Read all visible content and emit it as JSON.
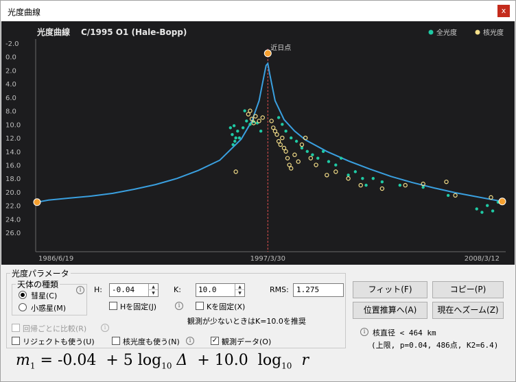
{
  "window": {
    "title": "光度曲線",
    "close_glyph": "x"
  },
  "chart": {
    "title": "光度曲線",
    "object": "C/1995 O1 (Hale-Bopp)",
    "legend": [
      "全光度",
      "核光度"
    ],
    "perihelion_label": "近日点",
    "colors": {
      "total": "#1fc9a4",
      "nucleus": "#f6e08a",
      "curve": "#3aa0e0",
      "marker": "#f5a030",
      "bg": "#1c1c1e"
    }
  },
  "chart_data": {
    "type": "scatter",
    "x_tick_labels": [
      "1986/6/19",
      "1997/3/30",
      "2008/3/12"
    ],
    "y_ticks": [
      "-2.0",
      "0.0",
      "2.0",
      "4.0",
      "6.0",
      "8.0",
      "10.0",
      "12.0",
      "14.0",
      "16.0",
      "18.0",
      "20.0",
      "22.0",
      "24.0",
      "26.0"
    ],
    "ylim": [
      -2,
      27
    ],
    "y_inverted": true,
    "xlim": [
      "1986/6/19",
      "2008/3/12"
    ],
    "perihelion": "1997/3/30",
    "model_curve": [
      [
        "1986/6/19",
        21.5
      ],
      [
        "1987/1/1",
        21.2
      ],
      [
        "1988/1/1",
        20.9
      ],
      [
        "1989/1/1",
        20.6
      ],
      [
        "1990/1/1",
        20.2
      ],
      [
        "1991/1/1",
        19.6
      ],
      [
        "1992/1/1",
        18.9
      ],
      [
        "1993/1/1",
        18.0
      ],
      [
        "1994/1/1",
        16.8
      ],
      [
        "1995/1/1",
        15.3
      ],
      [
        "1996/1/1",
        12.2
      ],
      [
        "1996/7/1",
        9.5
      ],
      [
        "1996/11/1",
        6.5
      ],
      [
        "1997/1/15",
        3.2
      ],
      [
        "1997/3/1",
        1.3
      ],
      [
        "1997/3/30",
        1.0
      ],
      [
        "1997/5/1",
        2.5
      ],
      [
        "1997/8/1",
        6.5
      ],
      [
        "1998/1/1",
        9.3
      ],
      [
        "1998/7/1",
        11.0
      ],
      [
        "1999/1/1",
        12.3
      ],
      [
        "2000/1/1",
        14.0
      ],
      [
        "2001/1/1",
        15.4
      ],
      [
        "2002/1/1",
        16.6
      ],
      [
        "2003/1/1",
        17.7
      ],
      [
        "2004/1/1",
        18.6
      ],
      [
        "2005/1/1",
        19.4
      ],
      [
        "2006/1/1",
        20.1
      ],
      [
        "2007/1/1",
        20.7
      ],
      [
        "2008/3/12",
        21.4
      ]
    ],
    "series": [
      {
        "name": "全光度",
        "points": [
          [
            "1995/7/1",
            10.5
          ],
          [
            "1995/8/1",
            11.5
          ],
          [
            "1995/9/1",
            10.2
          ],
          [
            "1995/10/1",
            12.0
          ],
          [
            "1995/11/1",
            11.0
          ],
          [
            "1996/2/1",
            10.5
          ],
          [
            "1996/4/1",
            9.5
          ],
          [
            "1996/6/1",
            10.0
          ],
          [
            "1996/8/1",
            9.6
          ],
          [
            "1996/10/1",
            9.8
          ],
          [
            "1996/12/1",
            11.0
          ],
          [
            "1995/8/15",
            13.0
          ],
          [
            "1995/9/15",
            12.5
          ],
          [
            "1995/12/1",
            12.0
          ],
          [
            "1996/3/1",
            8.0
          ],
          [
            "1997/10/1",
            9.0
          ],
          [
            "1997/12/1",
            10.0
          ],
          [
            "1998/2/1",
            11.0
          ],
          [
            "1998/5/1",
            12.0
          ],
          [
            "1998/8/1",
            12.5
          ],
          [
            "1998/11/1",
            13.5
          ],
          [
            "1999/2/1",
            14.0
          ],
          [
            "1999/5/1",
            14.5
          ],
          [
            "1999/8/1",
            15.0
          ],
          [
            "1999/11/1",
            14.0
          ],
          [
            "2000/2/1",
            15.5
          ],
          [
            "2000/6/1",
            16.0
          ],
          [
            "2000/9/1",
            15.0
          ],
          [
            "2001/1/1",
            17.5
          ],
          [
            "2001/5/1",
            17.0
          ],
          [
            "2001/9/1",
            18.0
          ],
          [
            "2001/11/1",
            19.0
          ],
          [
            "2002/3/1",
            18.0
          ],
          [
            "2002/8/1",
            18.5
          ],
          [
            "2003/6/1",
            19.0
          ],
          [
            "2004/7/1",
            19.3
          ],
          [
            "2005/9/1",
            20.5
          ],
          [
            "2007/1/1",
            22.5
          ],
          [
            "2007/4/1",
            23.0
          ],
          [
            "2007/7/1",
            22.0
          ],
          [
            "2007/10/1",
            22.8
          ],
          [
            "2008/1/1",
            21.5
          ]
        ]
      },
      {
        "name": "核光度",
        "points": [
          [
            "1996/5/1",
            8.5
          ],
          [
            "1996/7/1",
            9.2
          ],
          [
            "1996/9/1",
            8.8
          ],
          [
            "1996/11/1",
            9.5
          ],
          [
            "1997/1/1",
            9.0
          ],
          [
            "1996/6/1",
            8.0
          ],
          [
            "1996/8/1",
            9.8
          ],
          [
            "1995/10/1",
            17.0
          ],
          [
            "1997/6/1",
            9.5
          ],
          [
            "1997/7/1",
            10.5
          ],
          [
            "1997/8/1",
            11.0
          ],
          [
            "1997/9/1",
            11.5
          ],
          [
            "1997/10/1",
            12.5
          ],
          [
            "1997/11/1",
            13.0
          ],
          [
            "1997/12/1",
            12.0
          ],
          [
            "1998/1/1",
            13.5
          ],
          [
            "1998/2/1",
            14.0
          ],
          [
            "1998/3/1",
            15.0
          ],
          [
            "1998/4/1",
            16.0
          ],
          [
            "1998/5/1",
            16.5
          ],
          [
            "1998/7/1",
            14.5
          ],
          [
            "1998/9/1",
            15.5
          ],
          [
            "1998/11/1",
            13.0
          ],
          [
            "1999/1/1",
            12.0
          ],
          [
            "1999/4/1",
            15.0
          ],
          [
            "1999/7/1",
            16.0
          ],
          [
            "2000/1/1",
            17.5
          ],
          [
            "2000/6/1",
            17.0
          ],
          [
            "2001/1/1",
            18.0
          ],
          [
            "2001/8/1",
            19.0
          ],
          [
            "2002/8/1",
            19.5
          ],
          [
            "2003/9/1",
            19.0
          ],
          [
            "2004/7/1",
            18.8
          ],
          [
            "2005/8/1",
            18.5
          ],
          [
            "2006/1/1",
            20.5
          ],
          [
            "2007/9/1",
            20.8
          ]
        ]
      }
    ]
  },
  "params": {
    "group_label": "光度パラメータ",
    "body_type_label": "天体の種類",
    "comet": "彗星(C)",
    "asteroid": "小惑星(M)",
    "h_label": "H:",
    "h_value": "-0.04",
    "k_label": "K:",
    "k_value": "10.0",
    "rms_label": "RMS:",
    "rms_value": "1.275",
    "fix_h": "Hを固定(J)",
    "fix_k": "Kを固定(X)",
    "hint": "観測が少ないときはK=10.0を推奨",
    "compare_each": "回帰ごとに比較(R)",
    "use_rejected": "リジェクトも使う(U)",
    "use_nucleus": "核光度も使う(N)",
    "obs_data": "観測データ(O)",
    "obs_data_check": "✓",
    "nucleus_diameter": "核直径 < 464 km",
    "nucleus_detail": "(上限, p=0.04, 486点, K2=6.4)",
    "info_glyph": "i"
  },
  "buttons": {
    "fit": "フィット(F)",
    "copy": "コピー(P)",
    "to_position": "位置推算へ(A)",
    "zoom_now": "現在へズーム(Z)"
  },
  "formula": {
    "m": "m",
    "sub1": "1",
    "eq": "=",
    "h": "-0.04",
    "plus5": "+ 5",
    "log1": "log",
    "sub10a": "10",
    "delta": "Δ",
    "plusk": "+ 10.0",
    "log2": "log",
    "sub10b": "10",
    "r": "r"
  }
}
